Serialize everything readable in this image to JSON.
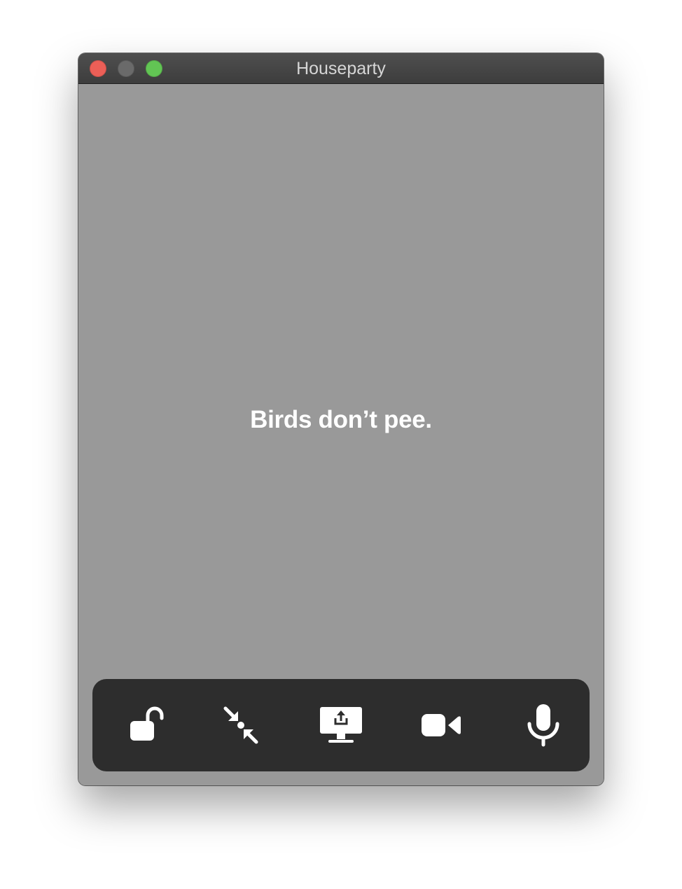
{
  "window": {
    "title": "Houseparty"
  },
  "main": {
    "fact_text": "Birds don’t pee."
  },
  "toolbar": {
    "buttons": [
      {
        "icon": "unlock-icon"
      },
      {
        "icon": "minimize-arrows-icon"
      },
      {
        "icon": "screen-share-icon"
      },
      {
        "icon": "video-camera-icon"
      },
      {
        "icon": "microphone-icon"
      }
    ]
  },
  "colors": {
    "close": "#ec5f57",
    "minimize": "#6a6a6a",
    "zoom": "#62c554",
    "background": "#999999",
    "toolbar": "#2d2d2d"
  }
}
